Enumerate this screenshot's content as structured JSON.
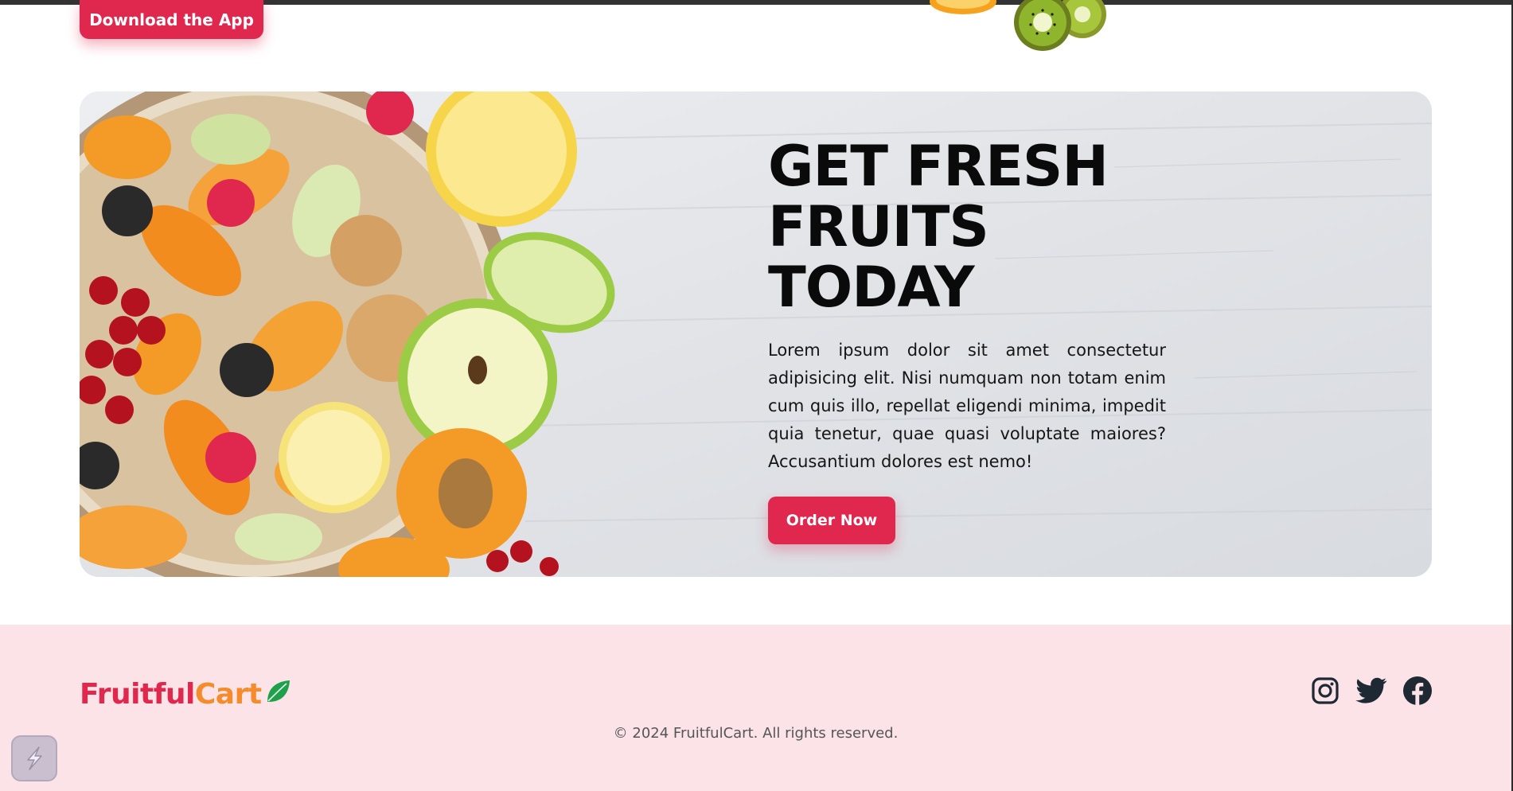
{
  "top": {
    "download_label": "Download the App"
  },
  "banner": {
    "headline": [
      "GET FRESH",
      "FRUITS",
      "TODAY"
    ],
    "description": "Lorem ipsum dolor sit amet consectetur adipisicing elit. Nisi numquam non totam enim cum quis illo, repellat eligendi minima, impedit quia tenetur, quae quasi voluptate maiores? Accusantium dolores est nemo!",
    "order_label": "Order Now"
  },
  "footer": {
    "logo_part1": "Fruitful",
    "logo_part2": "Cart",
    "socials": [
      "instagram-icon",
      "twitter-icon",
      "facebook-icon"
    ],
    "copyright": "© 2024 FruitfulCart. All rights reserved."
  },
  "colors": {
    "accent": "#e0284e",
    "orange": "#f58c2c",
    "leaf": "#1fa04b",
    "footer_bg": "#fbe3e8",
    "icon": "#1e2933"
  }
}
